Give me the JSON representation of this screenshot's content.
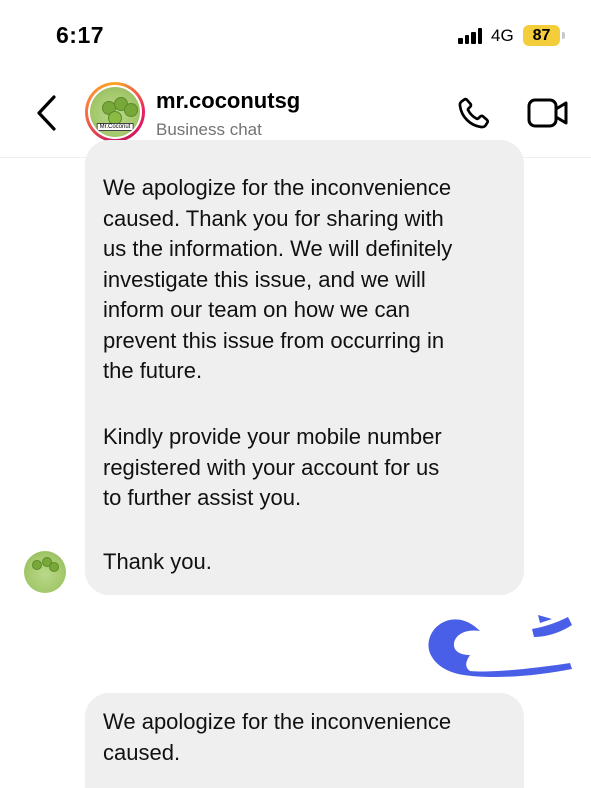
{
  "status_bar": {
    "time": "6:17",
    "network": "4G",
    "battery": "87",
    "battery_color": "#f4ce3a"
  },
  "header": {
    "back_icon": "chevron-left-icon",
    "name": "mr.coconutsg",
    "subtitle": "Business chat",
    "avatar_label": "Mr.Coconut",
    "call_icon": "phone-icon",
    "video_icon": "video-camera-icon"
  },
  "messages": [
    {
      "sender": "business",
      "paragraphs": [
        "We apologize for the inconvenience\ncaused. Thank you for sharing with\nus the information. We will definitely\ninvestigate this issue, and we will\ninform our team on how we can\nprevent this issue from occurring in\nthe future.",
        "Kindly provide your mobile number\nregistered with your account for us\nto further assist you.",
        "Thank you."
      ]
    },
    {
      "sender": "business",
      "paragraphs": [
        "We apologize for the inconvenience\ncaused."
      ]
    }
  ],
  "colors": {
    "bubble_bg": "#efefef",
    "sent_blob": "#4a5fe8"
  }
}
